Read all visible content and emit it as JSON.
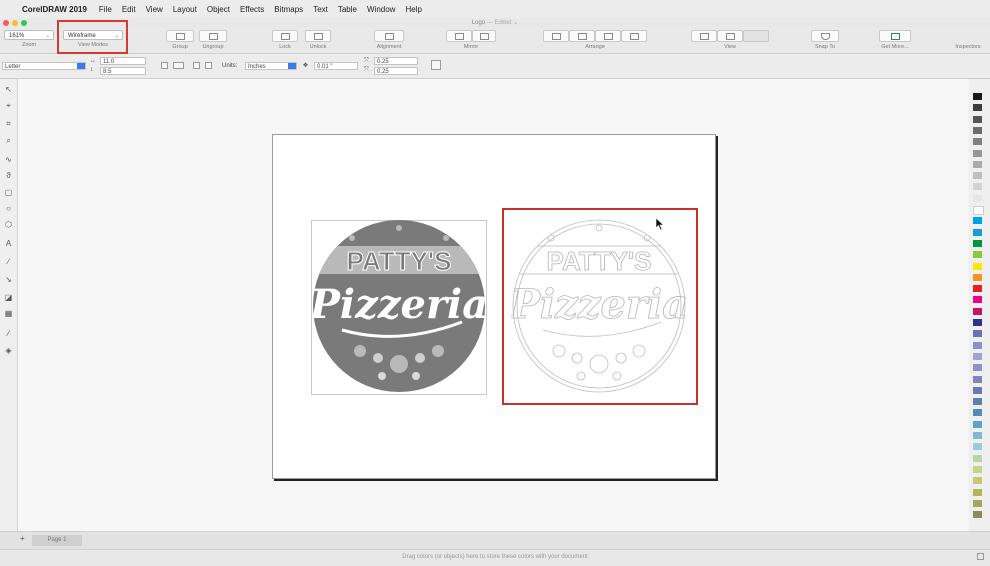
{
  "menubar": {
    "app_name": "CorelDRAW 2019",
    "items": [
      "File",
      "Edit",
      "View",
      "Layout",
      "Object",
      "Effects",
      "Bitmaps",
      "Text",
      "Table",
      "Window",
      "Help"
    ]
  },
  "window": {
    "title": "Logo",
    "title_suffix": "— Edited ⌄"
  },
  "toolbar": {
    "zoom_value": "161%",
    "zoom_label": "Zoom",
    "view_mode_value": "Wireframe",
    "view_mode_label": "View Modes",
    "group_label": "Group",
    "ungroup_label": "Ungroup",
    "lock_label": "Lock",
    "unlock_label": "Unlock",
    "alignment_label": "Alignment",
    "mirror_label": "Mirror",
    "arrange_label": "Arrange",
    "view_label": "View",
    "snap_label": "Snap To",
    "get_more_label": "Get More...",
    "inspectors_label": "Inspectors"
  },
  "propbar": {
    "page_size": "Letter",
    "width": "11.0",
    "height": "8.5",
    "units_label": "Units:",
    "units_value": "Inches",
    "nudge": "0.01 \"",
    "dup_x": "0.25",
    "dup_y": "0.25"
  },
  "logo": {
    "top_text": "PATTY'S",
    "script_text": "Pizzeria"
  },
  "pages": {
    "tab_label": "Page 1",
    "add": "+"
  },
  "status": {
    "hint": "Drag colors (or objects) here to store these colors with your document"
  },
  "colors": {
    "highlight": "#d33a32",
    "logo_dark": "#7a7a7a",
    "logo_light": "#b9b9b9"
  },
  "palette_swatches": [
    "#1a1a1a",
    "#3d3d3d",
    "#555555",
    "#6b6b6b",
    "#808080",
    "#969696",
    "#aaaaaa",
    "#bfbfbf",
    "#d3d3d3",
    "#e6e6e6",
    "#ffffff",
    "#00a0e6",
    "#1c9bd7",
    "#00963f",
    "#8dc63f",
    "#ffe500",
    "#f7931e",
    "#ed1c24",
    "#ec008c",
    "#c2185b",
    "#2e3192",
    "#6d6fb0",
    "#8c8fc9",
    "#9ea5d5",
    "#8b92c8",
    "#7f86bc",
    "#6c78b4",
    "#5b7fb0",
    "#4f8cb7",
    "#5ca3c6",
    "#7fb8d1",
    "#9acbd8",
    "#b7d4a4",
    "#c5d58a",
    "#c8c96a",
    "#b6b55a",
    "#a4a85e",
    "#8b8d55"
  ]
}
